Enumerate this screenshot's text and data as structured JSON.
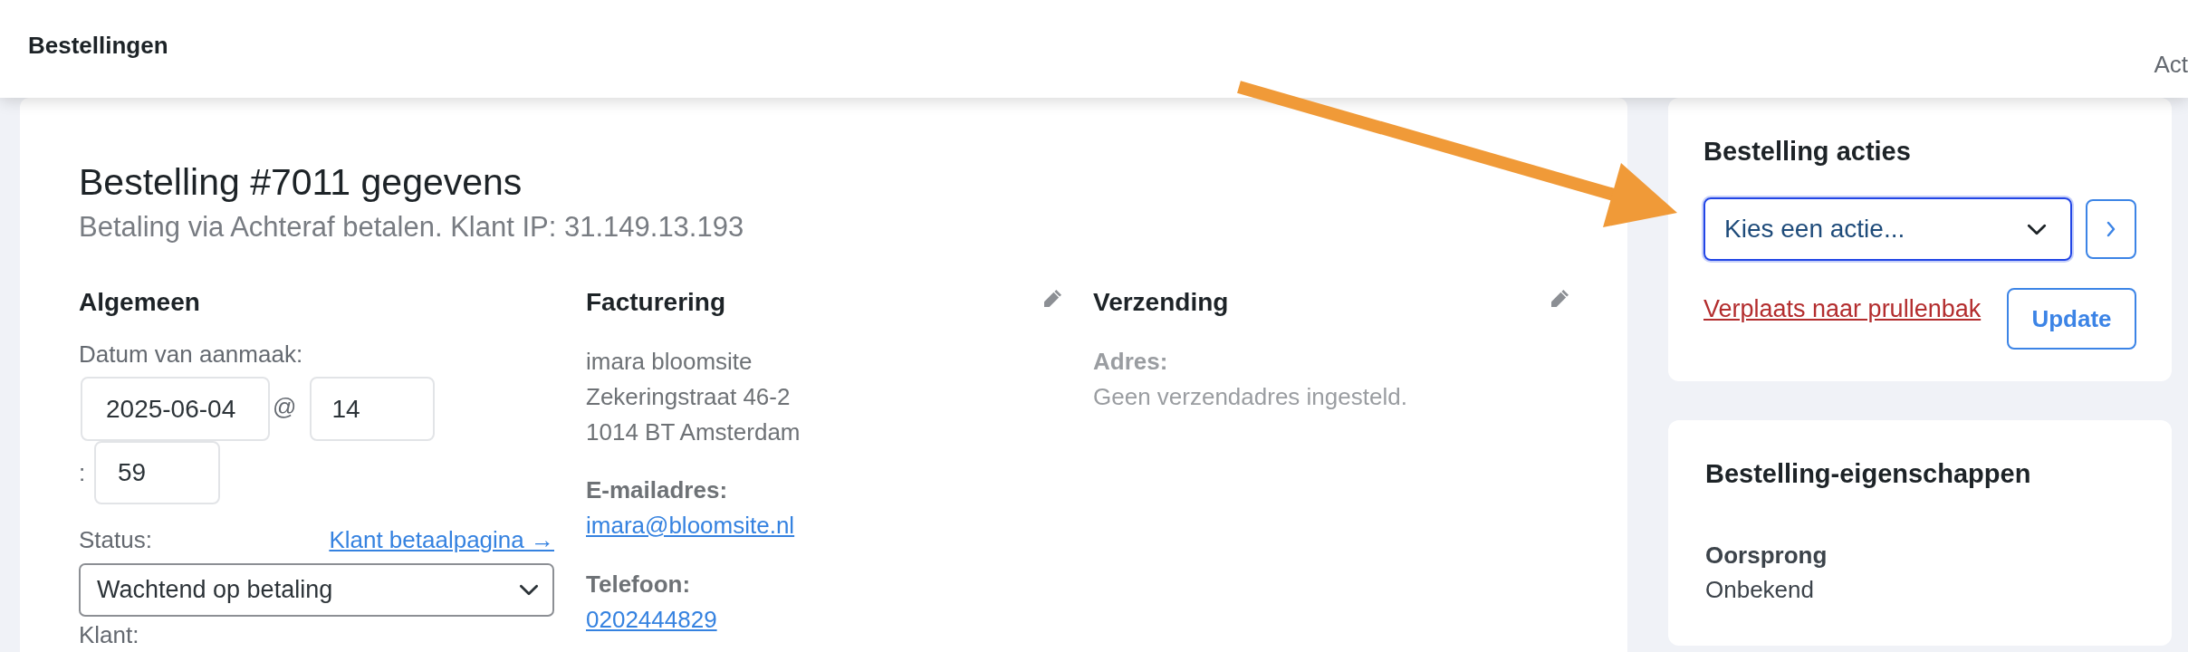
{
  "header": {
    "title": "Bestellingen",
    "right_text": "Act"
  },
  "order": {
    "title": "Bestelling #7011 gegevens",
    "subtitle": "Betaling via Achteraf betalen. Klant IP: 31.149.13.193",
    "general": {
      "heading": "Algemeen",
      "date_label": "Datum van aanmaak:",
      "date": "2025-06-04",
      "at": "@",
      "hour": "14",
      "colon": ":",
      "minute": "59",
      "status_label": "Status:",
      "payment_link": "Klant betaalpagina →",
      "status": "Wachtend op betaling",
      "customer_label": "Klant:"
    },
    "billing": {
      "heading": "Facturering",
      "address_lines": [
        "imara bloomsite",
        "Zekeringstraat 46-2",
        "1014 BT Amsterdam"
      ],
      "email_label": "E-mailadres:",
      "email": "imara@bloomsite.nl",
      "phone_label": "Telefoon:",
      "phone": "0202444829"
    },
    "shipping": {
      "heading": "Verzending",
      "address_label": "Adres:",
      "address": "Geen verzendadres ingesteld."
    }
  },
  "actions": {
    "heading": "Bestelling acties",
    "select": {
      "value": "Kies een actie...",
      "focused": true
    },
    "trash_link": "Verplaats naar prullenbak",
    "update_button": "Update"
  },
  "properties": {
    "heading": "Bestelling-eigenschappen",
    "fields": [
      {
        "label": "Oorsprong",
        "value": "Onbekend"
      }
    ]
  }
}
